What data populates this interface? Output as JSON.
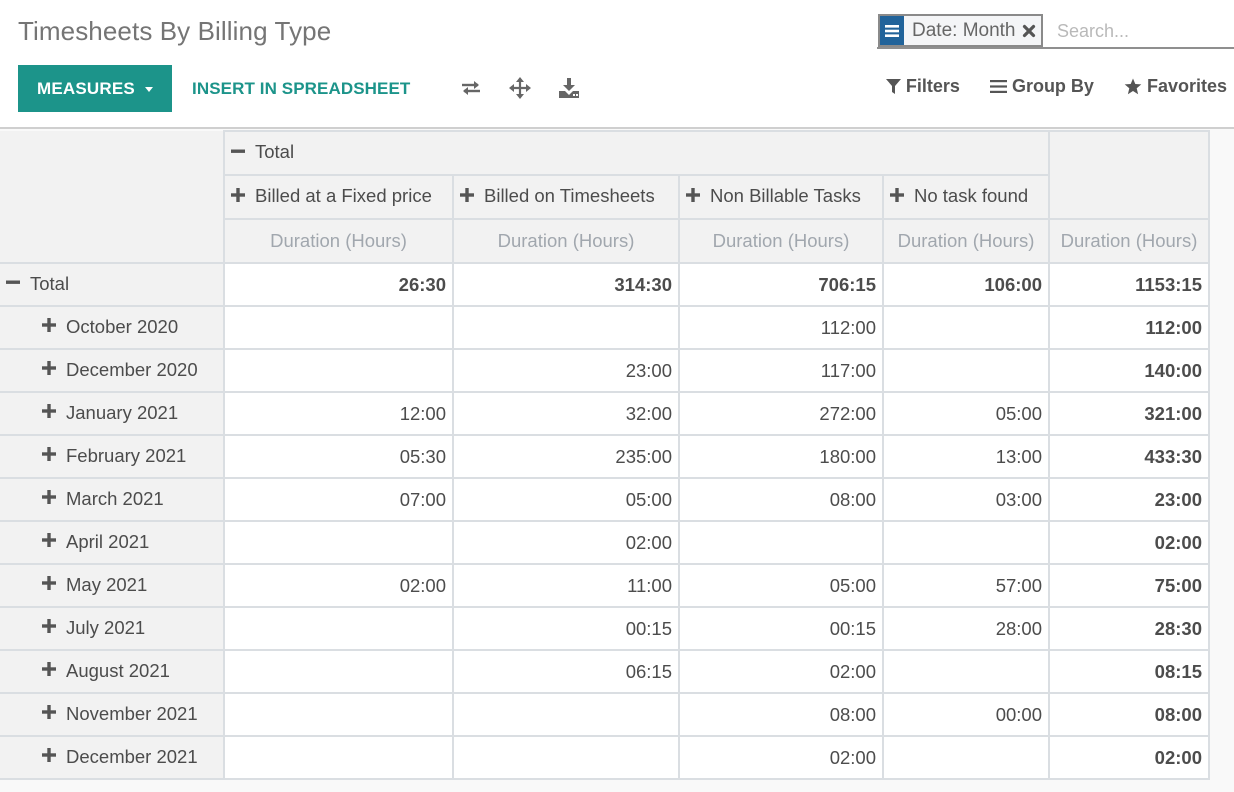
{
  "header": {
    "title": "Timesheets By Billing Type",
    "measures_label": "MEASURES",
    "insert_label": "INSERT IN SPREADSHEET",
    "tools": [
      {
        "name": "flip-axis-icon",
        "title": "Flip axis"
      },
      {
        "name": "expand-all-icon",
        "title": "Expand all"
      },
      {
        "name": "download-icon",
        "title": "Download xlsx"
      }
    ]
  },
  "search": {
    "facet_label": "Date: Month",
    "placeholder": "Search...",
    "value": "",
    "options": {
      "filters": "Filters",
      "group_by": "Group By",
      "favorites": "Favorites"
    }
  },
  "colors": {
    "accent": "#1c948a",
    "facet": "#21639a",
    "header_bg": "#f2f2f2",
    "border": "#dadee2",
    "measure_text": "#a1a7ae"
  },
  "pivot": {
    "col_group_label": "Total",
    "measure_label": "Duration (Hours)",
    "columns": [
      "Billed at a Fixed price",
      "Billed on Timesheets",
      "Non Billable Tasks",
      "No task found"
    ],
    "total_row": {
      "label": "Total",
      "values": [
        "26:30",
        "314:30",
        "706:15",
        "106:00"
      ],
      "total": "1153:15"
    },
    "rows": [
      {
        "label": "October 2020",
        "values": [
          "",
          "",
          "112:00",
          ""
        ],
        "total": "112:00"
      },
      {
        "label": "December 2020",
        "values": [
          "",
          "23:00",
          "117:00",
          ""
        ],
        "total": "140:00"
      },
      {
        "label": "January 2021",
        "values": [
          "12:00",
          "32:00",
          "272:00",
          "05:00"
        ],
        "total": "321:00"
      },
      {
        "label": "February 2021",
        "values": [
          "05:30",
          "235:00",
          "180:00",
          "13:00"
        ],
        "total": "433:30"
      },
      {
        "label": "March 2021",
        "values": [
          "07:00",
          "05:00",
          "08:00",
          "03:00"
        ],
        "total": "23:00"
      },
      {
        "label": "April 2021",
        "values": [
          "",
          "02:00",
          "",
          ""
        ],
        "total": "02:00"
      },
      {
        "label": "May 2021",
        "values": [
          "02:00",
          "11:00",
          "05:00",
          "57:00"
        ],
        "total": "75:00"
      },
      {
        "label": "July 2021",
        "values": [
          "",
          "00:15",
          "00:15",
          "28:00"
        ],
        "total": "28:30"
      },
      {
        "label": "August 2021",
        "values": [
          "",
          "06:15",
          "02:00",
          ""
        ],
        "total": "08:15"
      },
      {
        "label": "November 2021",
        "values": [
          "",
          "",
          "08:00",
          "00:00"
        ],
        "total": "08:00"
      },
      {
        "label": "December 2021",
        "values": [
          "",
          "",
          "02:00",
          ""
        ],
        "total": "02:00"
      }
    ]
  }
}
